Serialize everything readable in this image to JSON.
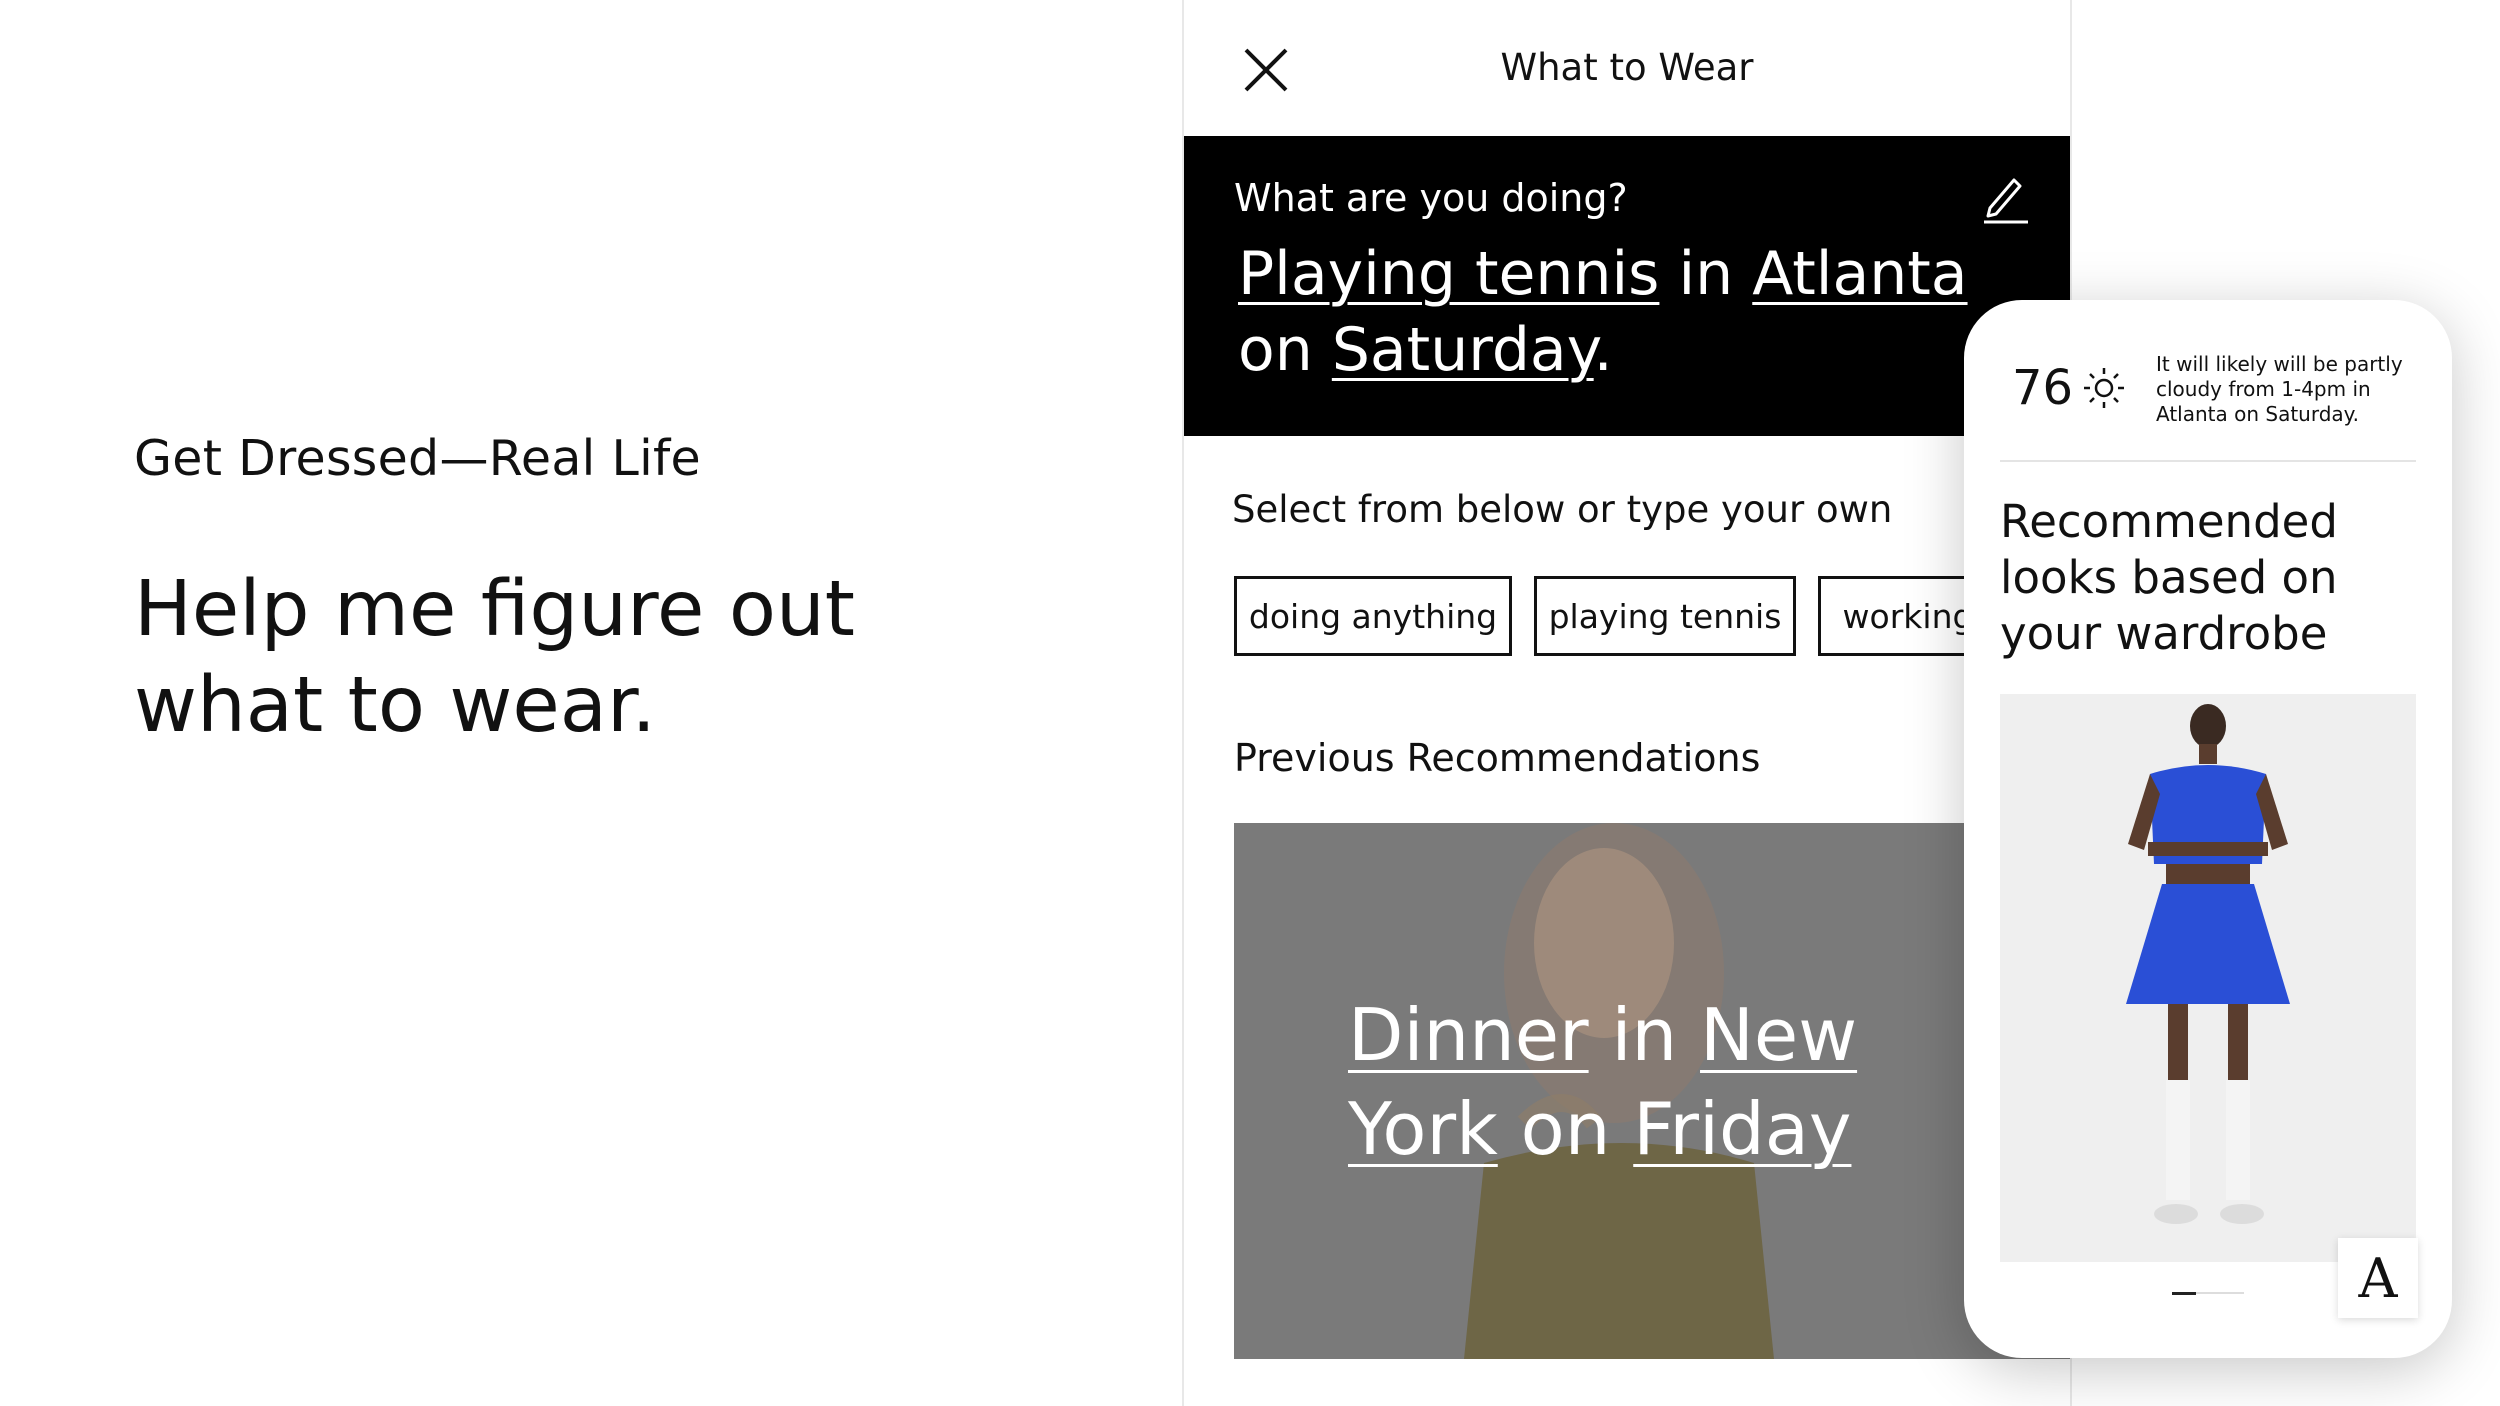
{
  "left": {
    "eyebrow": "Get Dressed—Real Life",
    "headline": "Help me figure out what to wear."
  },
  "header": {
    "title": "What to Wear",
    "close_icon": "close-icon"
  },
  "prompt": {
    "question": "What are you doing?",
    "edit_icon": "pencil-icon",
    "activity": "Playing tennis",
    "word_in": "in",
    "location": "Atlanta",
    "word_on": "on",
    "day": "Saturday",
    "period": "."
  },
  "suggestions": {
    "label": "Select from below or type your own",
    "chips": [
      "doing anything",
      "playing tennis",
      "working"
    ]
  },
  "previous": {
    "label": "Previous Recommendations",
    "card": {
      "activity": "Dinner",
      "word_in": "in",
      "location_line1": "New",
      "location_line2": "York",
      "word_on": "on",
      "day": "Friday"
    }
  },
  "weather_card": {
    "temperature": "76",
    "weather_icon": "sun-icon",
    "forecast": "It will likely will be partly cloudy from 1-4pm in Atlanta on Saturday.",
    "title": "Recommended looks based on your wardrobe",
    "brand_logo_text": "A",
    "pager": {
      "current": 1,
      "total": 3
    }
  },
  "colors": {
    "panel_bg": "#000000",
    "text": "#111111",
    "outfit_blue": "#2a4fd6"
  }
}
